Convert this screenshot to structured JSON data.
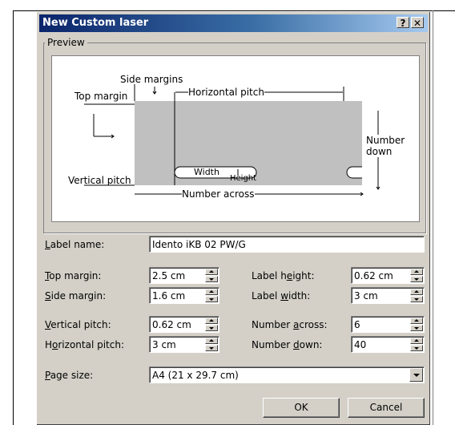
{
  "window": {
    "title": "New Custom laser",
    "help_label": "?",
    "close_label": "✕"
  },
  "preview": {
    "group_label": "Preview",
    "side_margins": "Side margins",
    "top_margin": "Top margin",
    "horizontal_pitch": "Horizontal pitch",
    "number_down": "Number down",
    "vertical_pitch": "Vertical pitch",
    "width": "Width",
    "height": "Height",
    "number_across": "Number across"
  },
  "form": {
    "label_name": {
      "key": "L",
      "rest": "abel name:",
      "value": "Idento iKB 02 PW/G"
    },
    "top_margin": {
      "key": "T",
      "rest": "op margin:",
      "value": "2.5 cm"
    },
    "side_margin": {
      "key": "S",
      "rest": "ide margin:",
      "value": "1.6 cm"
    },
    "vertical_pitch": {
      "key": "V",
      "rest": "ertical pitch:",
      "value": "0.62 cm"
    },
    "horizontal_pitch": {
      "pre": "H",
      "key": "o",
      "rest": "rizontal pitch:",
      "value": "3 cm"
    },
    "label_height": {
      "pre": "Label h",
      "key": "e",
      "rest": "ight:",
      "value": "0.62 cm"
    },
    "label_width": {
      "pre": "Label ",
      "key": "w",
      "rest": "idth:",
      "value": "3 cm"
    },
    "number_across": {
      "pre": "Number ",
      "key": "a",
      "rest": "cross:",
      "value": "6"
    },
    "number_down": {
      "pre": "Number ",
      "key": "d",
      "rest": "own:",
      "value": "40"
    },
    "page_size": {
      "key": "P",
      "rest": "age size:",
      "value": "A4 (21 x 29.7 cm)"
    }
  },
  "buttons": {
    "ok": "OK",
    "cancel": "Cancel"
  }
}
